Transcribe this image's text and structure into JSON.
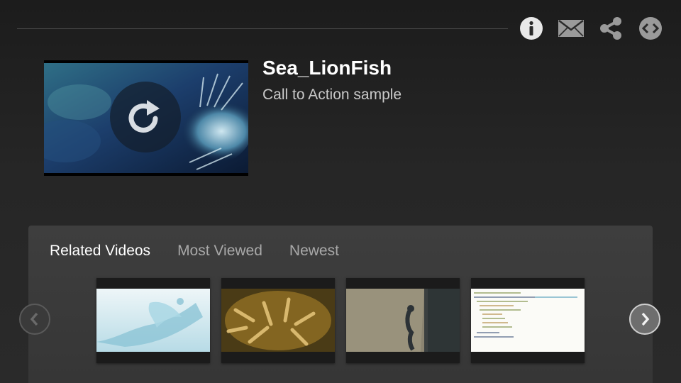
{
  "toolbar": {
    "icons": [
      "info-icon",
      "email-icon",
      "share-icon",
      "embed-icon"
    ],
    "icon_color": "#9a9a9a"
  },
  "video": {
    "title": "Sea_LionFish",
    "subtitle": "Call to Action sample",
    "overlay_icon": "replay-icon"
  },
  "related": {
    "tabs": [
      {
        "label": "Related Videos",
        "active": true
      },
      {
        "label": "Most Viewed",
        "active": false
      },
      {
        "label": "Newest",
        "active": false
      }
    ],
    "thumbnails": [
      {
        "subject": "water splash"
      },
      {
        "subject": "sea anemone"
      },
      {
        "subject": "seahorse"
      },
      {
        "subject": "code screenshot"
      }
    ],
    "prev_icon": "chevron-left-icon",
    "next_icon": "chevron-right-icon"
  },
  "colors": {
    "background": "#262626",
    "panel": "#3a3a3a",
    "tab_active": "#ffffff",
    "tab_inactive": "#a8a8a8"
  }
}
